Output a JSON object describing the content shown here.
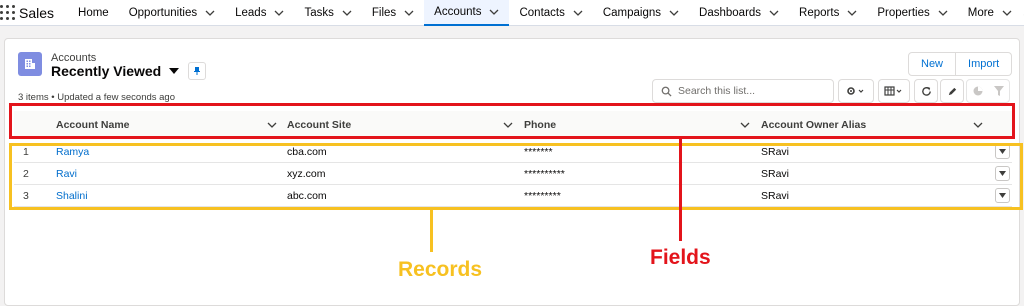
{
  "app": {
    "name": "Sales"
  },
  "nav": {
    "items": [
      {
        "label": "Home",
        "dropdown": false,
        "active": false
      },
      {
        "label": "Opportunities",
        "dropdown": true,
        "active": false
      },
      {
        "label": "Leads",
        "dropdown": true,
        "active": false
      },
      {
        "label": "Tasks",
        "dropdown": true,
        "active": false
      },
      {
        "label": "Files",
        "dropdown": true,
        "active": false
      },
      {
        "label": "Accounts",
        "dropdown": true,
        "active": true
      },
      {
        "label": "Contacts",
        "dropdown": true,
        "active": false
      },
      {
        "label": "Campaigns",
        "dropdown": true,
        "active": false
      },
      {
        "label": "Dashboards",
        "dropdown": true,
        "active": false
      },
      {
        "label": "Reports",
        "dropdown": true,
        "active": false
      },
      {
        "label": "Properties",
        "dropdown": true,
        "active": false
      },
      {
        "label": "More",
        "dropdown": true,
        "active": false
      }
    ]
  },
  "list_view": {
    "object_label": "Accounts",
    "title": "Recently Viewed",
    "status": "3 items • Updated a few seconds ago",
    "buttons": {
      "new": "New",
      "import": "Import"
    },
    "search": {
      "placeholder": "Search this list..."
    }
  },
  "table": {
    "columns": [
      "Account Name",
      "Account Site",
      "Phone",
      "Account Owner Alias"
    ],
    "rows": [
      {
        "num": "1",
        "name": "Ramya",
        "site": "cba.com",
        "phone": "*******",
        "owner": "SRavi"
      },
      {
        "num": "2",
        "name": "Ravi",
        "site": "xyz.com",
        "phone": "**********",
        "owner": "SRavi"
      },
      {
        "num": "3",
        "name": "Shalini",
        "site": "abc.com",
        "phone": "*********",
        "owner": "SRavi"
      }
    ]
  },
  "annotations": {
    "records": "Records",
    "fields": "Fields",
    "records_color": "#f7c121",
    "fields_color": "#e3141b"
  },
  "colors": {
    "accent": "#0070d2",
    "object_icon": "#7f8de1",
    "link": "#006dcc"
  }
}
